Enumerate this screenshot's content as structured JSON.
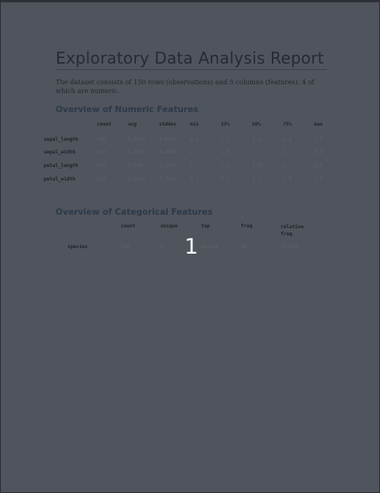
{
  "report": {
    "title": "Exploratory Data Analysis Report",
    "intro": "The dataset consists of 150 rows (observations) and 5 columns (features), 4 of which are numeric."
  },
  "numeric": {
    "heading": "Overview of Numeric Features",
    "columns": [
      "count",
      "avg",
      "stddev",
      "min",
      "25%",
      "50%",
      "75%",
      "max"
    ],
    "rows": [
      {
        "label": "sepal_length",
        "values": [
          "150",
          "5.8433",
          "0.8281",
          "4.3",
          "5.1",
          "5.8",
          "6.4",
          "7.9"
        ]
      },
      {
        "label": "sepal_width",
        "values": [
          "150",
          "3.0573",
          "0.4359",
          "2",
          "2.8",
          "3",
          "3.3",
          "4.4"
        ]
      },
      {
        "label": "petal_length",
        "values": [
          "150",
          "3.758",
          "1.7653",
          "1",
          "1.6",
          "4.35",
          "5.1",
          "6.9"
        ]
      },
      {
        "label": "petal_width",
        "values": [
          "150",
          "1.1993",
          "0.7622",
          "0.1",
          "0.3",
          "1.3",
          "1.8",
          "2.5"
        ]
      }
    ]
  },
  "categorical": {
    "heading": "Overview of Categorical Features",
    "columns": [
      "count",
      "unique",
      "top",
      "freq",
      "relative\nfreq"
    ],
    "rows": [
      {
        "label": "species",
        "values": [
          "150",
          "3",
          "setosa",
          "50",
          "33.33%"
        ]
      }
    ]
  },
  "page_number": "1"
}
